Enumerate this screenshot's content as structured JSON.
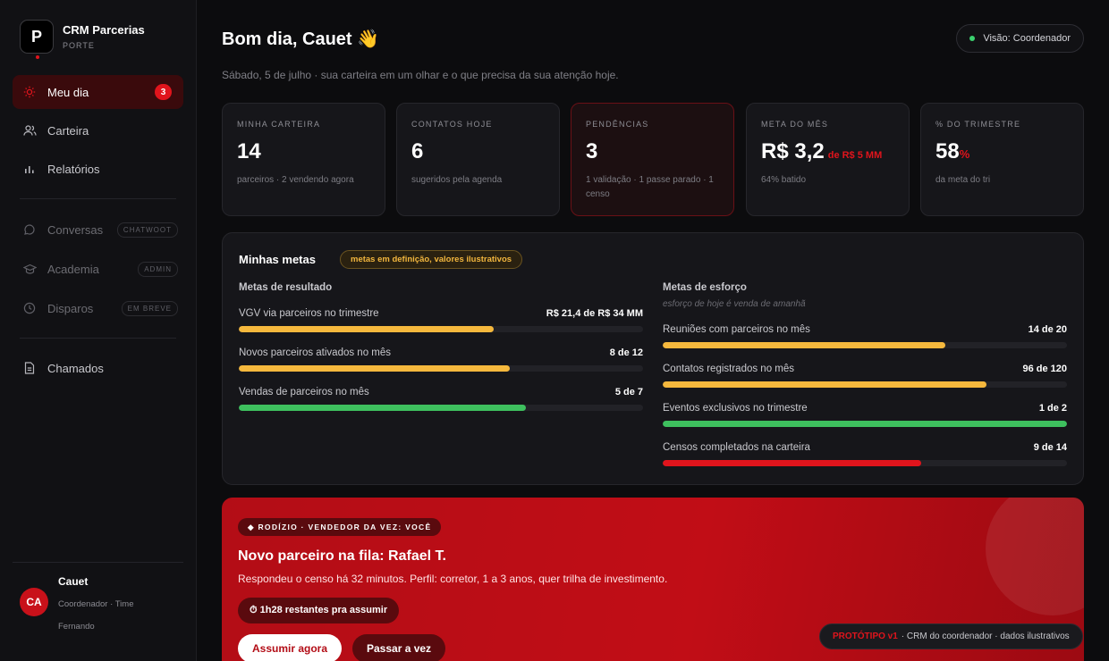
{
  "brand": {
    "logo_letter": "P",
    "title": "CRM Parcerias",
    "subtitle": "PORTE"
  },
  "nav": {
    "items": [
      {
        "label": "Meu dia",
        "icon": "sun-icon",
        "badge": "3",
        "active": true
      },
      {
        "label": "Carteira",
        "icon": "users-icon"
      },
      {
        "label": "Relatórios",
        "icon": "bar-chart-icon"
      }
    ],
    "locked": [
      {
        "label": "Conversas",
        "icon": "chat-icon",
        "tag": "CHATWOOT"
      },
      {
        "label": "Academia",
        "icon": "graduation-cap-icon",
        "tag": "ADMIN"
      },
      {
        "label": "Disparos",
        "icon": "clock-icon",
        "tag": "EM BREVE"
      }
    ],
    "extra": [
      {
        "label": "Chamados",
        "icon": "document-icon"
      }
    ]
  },
  "user": {
    "initials": "CA",
    "name": "Cauet",
    "role": "Coordenador · Time Fernando"
  },
  "header": {
    "greeting": "Bom dia, Cauet",
    "wave": "👋",
    "subtitle": "Sábado, 5 de julho · sua carteira em um olhar e o que precisa da sua atenção hoje.",
    "view_label": "Visão: Coordenador"
  },
  "stats": [
    {
      "label": "MINHA CARTEIRA",
      "value": "14",
      "note": "parceiros · 2 vendendo agora"
    },
    {
      "label": "CONTATOS HOJE",
      "value": "6",
      "note": "sugeridos pela agenda"
    },
    {
      "label": "PENDÊNCIAS",
      "value": "3",
      "note": "1 validação · 1 passe parado · 1 censo"
    },
    {
      "label": "META DO MÊS",
      "value": "R$ 3,2",
      "value_extra": "de R$ 5 MM",
      "note": "64% batido"
    },
    {
      "label": "% DO TRIMESTRE",
      "value": "58",
      "value_extra": "%",
      "note": "da meta do tri"
    }
  ],
  "goals": {
    "title": "Minhas metas",
    "badge": "metas em definição, valores ilustrativos",
    "result_title": "Metas de resultado",
    "effort_title": "Metas de esforço",
    "effort_hint": "esforço de hoje é venda de amanhã",
    "result": [
      {
        "label": "VGV via parceiros no trimestre",
        "value": "R$ 21,4 de R$ 34 MM",
        "progress": 0.63,
        "color": "#f5b83d"
      },
      {
        "label": "Novos parceiros ativados no mês",
        "value": "8 de 12",
        "progress": 0.67,
        "color": "#f5b83d"
      },
      {
        "label": "Vendas de parceiros no mês",
        "value": "5 de 7",
        "progress": 0.71,
        "color": "#3ec05e"
      }
    ],
    "effort": [
      {
        "label": "Reuniões com parceiros no mês",
        "value": "14 de 20",
        "progress": 0.7,
        "color": "#f5b83d"
      },
      {
        "label": "Contatos registrados no mês",
        "value": "96 de 120",
        "progress": 0.8,
        "color": "#f5b83d"
      },
      {
        "label": "Eventos exclusivos no trimestre",
        "value": "1 de 2",
        "progress": 1.0,
        "color": "#3ec05e"
      },
      {
        "label": "Censos completados na carteira",
        "value": "9 de 14",
        "progress": 0.64,
        "color": "#e0141c"
      }
    ]
  },
  "rodizio": {
    "tag": "◆ RODÍZIO · VENDEDOR DA VEZ: VOCÊ",
    "title": "Novo parceiro na fila: Rafael T.",
    "desc": "Respondeu o censo há 32 minutos. Perfil: corretor, 1 a 3 anos, quer trilha de investimento.",
    "timer": "⏱ 1h28 restantes pra assumir",
    "primary": "Assumir agora",
    "secondary": "Passar a vez"
  },
  "prototype": {
    "tag": "PROTÓTIPO v1",
    "text": "· CRM do coordenador · dados ilustrativos"
  },
  "colors": {
    "accent": "#e0141c",
    "amber": "#f5b83d",
    "green": "#3ec05e"
  }
}
